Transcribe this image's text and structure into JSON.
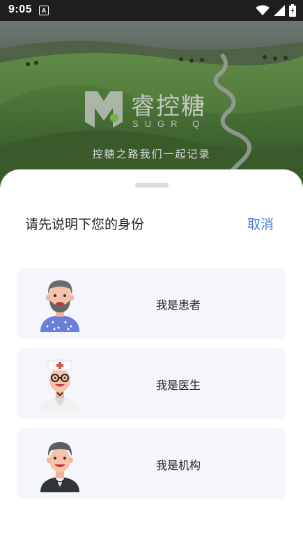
{
  "status_bar": {
    "time": "9:05",
    "notification_icon": "A"
  },
  "hero": {
    "brand_name": "睿控糖",
    "brand_sub": "SUGR Q",
    "tagline": "控糖之路我们一起记录"
  },
  "sheet": {
    "title": "请先说明下您的身份",
    "cancel_label": "取消",
    "options": [
      {
        "label": "我是患者",
        "icon": "patient-avatar"
      },
      {
        "label": "我是医生",
        "icon": "doctor-avatar"
      },
      {
        "label": "我是机构",
        "icon": "institution-avatar"
      }
    ]
  },
  "colors": {
    "accent": "#3a7fe0",
    "card_bg": "#f5f6fb"
  }
}
